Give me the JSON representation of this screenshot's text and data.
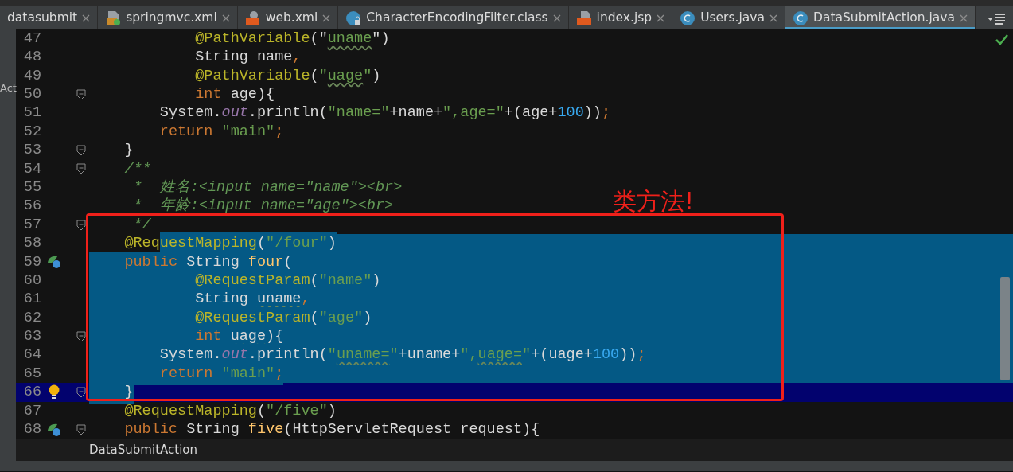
{
  "tabs": [
    {
      "label": "datasubmit",
      "kind": "none",
      "selected": false
    },
    {
      "label": "springmvc.xml",
      "kind": "xml",
      "selected": false
    },
    {
      "label": "web.xml",
      "kind": "webxml",
      "selected": false
    },
    {
      "label": "CharacterEncodingFilter.class",
      "kind": "class",
      "selected": false
    },
    {
      "label": "index.jsp",
      "kind": "jsp",
      "selected": false
    },
    {
      "label": "Users.java",
      "kind": "java",
      "selected": false
    },
    {
      "label": "DataSubmitAction.java",
      "kind": "java",
      "selected": true
    }
  ],
  "side_panel": {
    "label": "Act"
  },
  "editor": {
    "lines": [
      {
        "number": "47",
        "tokens": [
          {
            "kind": "annotation",
            "text": "            @PathVariable"
          },
          {
            "kind": "plain",
            "text": "(\""
          },
          {
            "kind": "string",
            "text": "uname",
            "typo": true
          },
          {
            "kind": "plain",
            "text": "\")"
          }
        ]
      },
      {
        "number": "48",
        "tokens": [
          {
            "kind": "plain",
            "text": "            String name"
          },
          {
            "kind": "keyword",
            "text": ","
          }
        ]
      },
      {
        "number": "49",
        "tokens": [
          {
            "kind": "annotation",
            "text": "            @PathVariable"
          },
          {
            "kind": "plain",
            "text": "("
          },
          {
            "kind": "string",
            "text": "\""
          },
          {
            "kind": "string",
            "text": "uage",
            "typo": true
          },
          {
            "kind": "string",
            "text": "\""
          },
          {
            "kind": "plain",
            "text": ")"
          }
        ]
      },
      {
        "number": "50",
        "fold": true,
        "tokens": [
          {
            "kind": "keyword",
            "text": "            int"
          },
          {
            "kind": "plain",
            "text": " age){"
          }
        ]
      },
      {
        "number": "51",
        "tokens": [
          {
            "kind": "plain",
            "text": "        System."
          },
          {
            "kind": "field",
            "text": "out"
          },
          {
            "kind": "plain",
            "text": ".println("
          },
          {
            "kind": "string",
            "text": "\"name=\""
          },
          {
            "kind": "plain",
            "text": "+name+"
          },
          {
            "kind": "string",
            "text": "\",age=\""
          },
          {
            "kind": "plain",
            "text": "+(age+"
          },
          {
            "kind": "number",
            "text": "100"
          },
          {
            "kind": "plain",
            "text": "))"
          },
          {
            "kind": "keyword",
            "text": ";"
          }
        ]
      },
      {
        "number": "52",
        "tokens": [
          {
            "kind": "keyword",
            "text": "        return"
          },
          {
            "kind": "string",
            "text": " \"main\""
          },
          {
            "kind": "keyword",
            "text": ";"
          }
        ]
      },
      {
        "number": "53",
        "fold": true,
        "tokens": [
          {
            "kind": "plain",
            "text": "    }"
          }
        ]
      },
      {
        "number": "54",
        "fold": true,
        "tokens": [
          {
            "kind": "comment",
            "text": "    /**"
          }
        ]
      },
      {
        "number": "55",
        "tokens": [
          {
            "kind": "comment",
            "text": "     *  姓名:<input name=\"name\"><br>"
          }
        ]
      },
      {
        "number": "56",
        "tokens": [
          {
            "kind": "comment",
            "text": "     *  年龄:<input name=\"age\"><br>"
          }
        ]
      },
      {
        "number": "57",
        "fold": true,
        "tokens": [
          {
            "kind": "comment",
            "text": "     */"
          }
        ]
      },
      {
        "number": "58",
        "selection_tail": true,
        "tokens": [
          {
            "kind": "annotation",
            "text": "    @Req"
          },
          {
            "kind": "annotation",
            "text": "uestMapping",
            "selected": true
          },
          {
            "kind": "plain",
            "text": "(",
            "selected": true
          },
          {
            "kind": "string",
            "text": "\"/four\"",
            "selected": true
          },
          {
            "kind": "plain",
            "text": ")",
            "selected": true
          }
        ]
      },
      {
        "number": "59",
        "bean": true,
        "selection_tail": true,
        "tokens": [
          {
            "kind": "keyword",
            "text": "    public",
            "selected": true
          },
          {
            "kind": "plain",
            "text": " String ",
            "selected": true
          },
          {
            "kind": "method",
            "text": "four",
            "selected": true
          },
          {
            "kind": "plain",
            "text": "(",
            "selected": true
          }
        ]
      },
      {
        "number": "60",
        "selection_tail": true,
        "tokens": [
          {
            "kind": "annotation",
            "text": "            @RequestParam",
            "selected": true
          },
          {
            "kind": "plain",
            "text": "(",
            "selected": true
          },
          {
            "kind": "string",
            "text": "\"name\"",
            "selected": true
          },
          {
            "kind": "plain",
            "text": ")",
            "selected": true
          }
        ]
      },
      {
        "number": "61",
        "selection_tail": true,
        "tokens": [
          {
            "kind": "plain",
            "text": "            String ",
            "selected": true
          },
          {
            "kind": "plain",
            "text": "uname",
            "selected": true,
            "typo": true
          },
          {
            "kind": "keyword",
            "text": ",",
            "selected": true
          }
        ]
      },
      {
        "number": "62",
        "selection_tail": true,
        "tokens": [
          {
            "kind": "annotation",
            "text": "            @RequestParam",
            "selected": true
          },
          {
            "kind": "plain",
            "text": "(",
            "selected": true
          },
          {
            "kind": "string",
            "text": "\"age\"",
            "selected": true
          },
          {
            "kind": "plain",
            "text": ")",
            "selected": true
          }
        ]
      },
      {
        "number": "63",
        "fold": true,
        "selection_tail": true,
        "tokens": [
          {
            "kind": "keyword",
            "text": "            int ",
            "selected": true
          },
          {
            "kind": "plain",
            "text": "uage",
            "selected": true,
            "typo": true
          },
          {
            "kind": "plain",
            "text": "){",
            "selected": true
          }
        ]
      },
      {
        "number": "64",
        "selection_tail": true,
        "tokens": [
          {
            "kind": "plain",
            "text": "        System.",
            "selected": true
          },
          {
            "kind": "field",
            "text": "out",
            "selected": true
          },
          {
            "kind": "plain",
            "text": ".println(",
            "selected": true
          },
          {
            "kind": "string",
            "text": "\"",
            "selected": true
          },
          {
            "kind": "string",
            "text": "uname=",
            "selected": true,
            "typo": true
          },
          {
            "kind": "string",
            "text": "\"",
            "selected": true
          },
          {
            "kind": "plain",
            "text": "+uname+",
            "selected": true
          },
          {
            "kind": "string",
            "text": "\",",
            "selected": true
          },
          {
            "kind": "string",
            "text": "uage=",
            "selected": true,
            "typo": true
          },
          {
            "kind": "string",
            "text": "\"",
            "selected": true
          },
          {
            "kind": "plain",
            "text": "+(uage+",
            "selected": true
          },
          {
            "kind": "number",
            "text": "100",
            "selected": true
          },
          {
            "kind": "plain",
            "text": "))",
            "selected": true
          },
          {
            "kind": "keyword",
            "text": ";",
            "selected": true
          }
        ]
      },
      {
        "number": "65",
        "selection_tail": true,
        "tokens": [
          {
            "kind": "keyword",
            "text": "        return",
            "selected": true
          },
          {
            "kind": "string",
            "text": " \"main\"",
            "selected": true
          },
          {
            "kind": "keyword",
            "text": ";",
            "selected": true
          }
        ]
      },
      {
        "number": "66",
        "fold": true,
        "caret": true,
        "bulb": true,
        "tokens": [
          {
            "kind": "plain",
            "text": "    }",
            "selected": true
          }
        ]
      },
      {
        "number": "67",
        "tokens": [
          {
            "kind": "annotation",
            "text": "    @RequestMapping"
          },
          {
            "kind": "plain",
            "text": "("
          },
          {
            "kind": "string",
            "text": "\"/five\""
          },
          {
            "kind": "plain",
            "text": ")"
          }
        ]
      },
      {
        "number": "68",
        "fold": true,
        "bean": true,
        "tokens": [
          {
            "kind": "keyword",
            "text": "    public"
          },
          {
            "kind": "plain",
            "text": " String "
          },
          {
            "kind": "method",
            "text": "five"
          },
          {
            "kind": "plain",
            "text": "(HttpServletRequest request){"
          }
        ]
      }
    ]
  },
  "annotation": {
    "text": "类方法!"
  },
  "breadcrumb": {
    "label": "DataSubmitAction"
  }
}
